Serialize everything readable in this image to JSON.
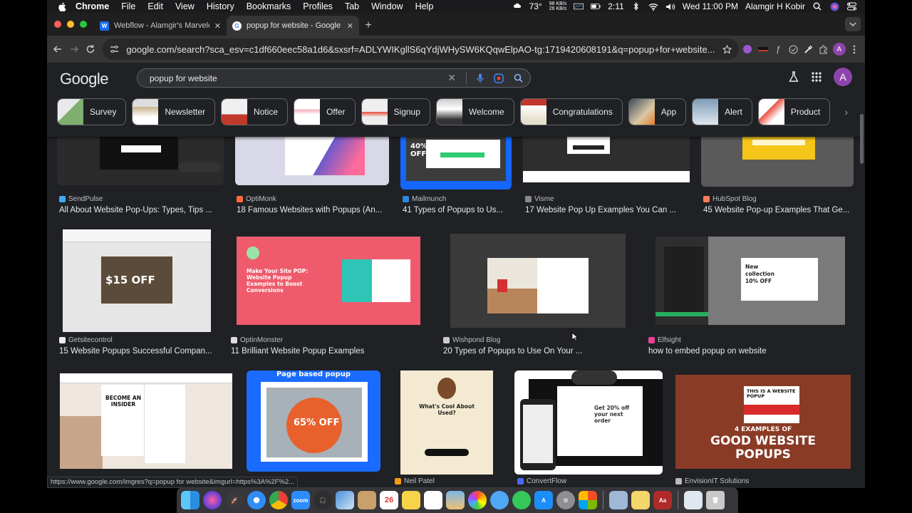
{
  "menubar": {
    "items": [
      "Chrome",
      "File",
      "Edit",
      "View",
      "History",
      "Bookmarks",
      "Profiles",
      "Tab",
      "Window",
      "Help"
    ],
    "temperature": "73°",
    "net_up": "98 KB/s",
    "net_down": "26 KB/s",
    "time_short": "2:11",
    "datetime": "Wed 11:00 PM",
    "user": "Alamgir H Kobir"
  },
  "tabs": [
    {
      "title": "Webflow - Alamgir's Marvelous",
      "favicon": "W"
    },
    {
      "title": "popup for website - Google Search",
      "favicon": "G"
    }
  ],
  "toolbar": {
    "url": "google.com/search?sca_esv=c1df660eec58a1d6&sxsrf=ADLYWIKgllS6qYdjWHySW6KQqwElpAO-tg:1719420608191&q=popup+for+website...",
    "profile_initial": "A"
  },
  "google": {
    "logo": "Google",
    "query": "popup for website",
    "avatar_initial": "A"
  },
  "chips": [
    "Survey",
    "Newsletter",
    "Notice",
    "Offer",
    "Signup",
    "Welcome",
    "Congratulations",
    "App",
    "Alert",
    "Product"
  ],
  "results": {
    "row1": [
      {
        "source": "SendPulse",
        "caption": "All About Website Pop-Ups: Types, Tips ..."
      },
      {
        "source": "OptiMonk",
        "caption": "18 Famous Websites with Popups (An..."
      },
      {
        "source": "Mailmunch",
        "caption": "41 Types of Popups to Us..."
      },
      {
        "source": "Visme",
        "caption": "17 Website Pop Up Examples You Can ..."
      },
      {
        "source": "HubSpot Blog",
        "caption": "45 Website Pop-up Examples That Ge..."
      }
    ],
    "row2": [
      {
        "source": "Getsitecontrol",
        "caption": "15 Website Popups Successful Compan..."
      },
      {
        "source": "OptinMonster",
        "caption": "11 Brilliant Website Popup Examples"
      },
      {
        "source": "Wishpond Blog",
        "caption": "20 Types of Popups to Use On Your ..."
      },
      {
        "source": "Elfsight",
        "caption": "how to embed popup on website"
      }
    ],
    "row3": [
      {
        "source": "",
        "caption": ""
      },
      {
        "source": "",
        "caption": ""
      },
      {
        "source": "Neil Patel",
        "caption": ""
      },
      {
        "source": "ConvertFlow",
        "caption": ""
      },
      {
        "source": "EnvisionIT Solutions",
        "caption": ""
      }
    ]
  },
  "image_text": {
    "forty_off": "40%",
    "forty_off_sub": "OFF",
    "fifteen_off": "$15 OFF",
    "optin_headline": "Make Your Site POP: Website Popup Examples to Boost Conversions",
    "elfsight_offer": "New collection 10% OFF",
    "page_based": "Page based popup",
    "sixtyfive_off": "65% OFF",
    "cool_title": "What's Cool About Used?",
    "convertflow_offer": "Get 20% off your next order",
    "good_popups_small": "4 EXAMPLES OF",
    "good_popups_big": "GOOD WEBSITE POPUPS",
    "become_insider": "BECOME AN INSIDER",
    "this_is": "THIS IS A WEBSITE POPUP"
  },
  "statusbar": "https://www.google.com/imgres?q=popup for website&imgurl=https%3A%2F%2...",
  "colors": {
    "google_bg": "#202124",
    "accent_blue": "#1a73e8",
    "avatar": "#8e44ad"
  }
}
